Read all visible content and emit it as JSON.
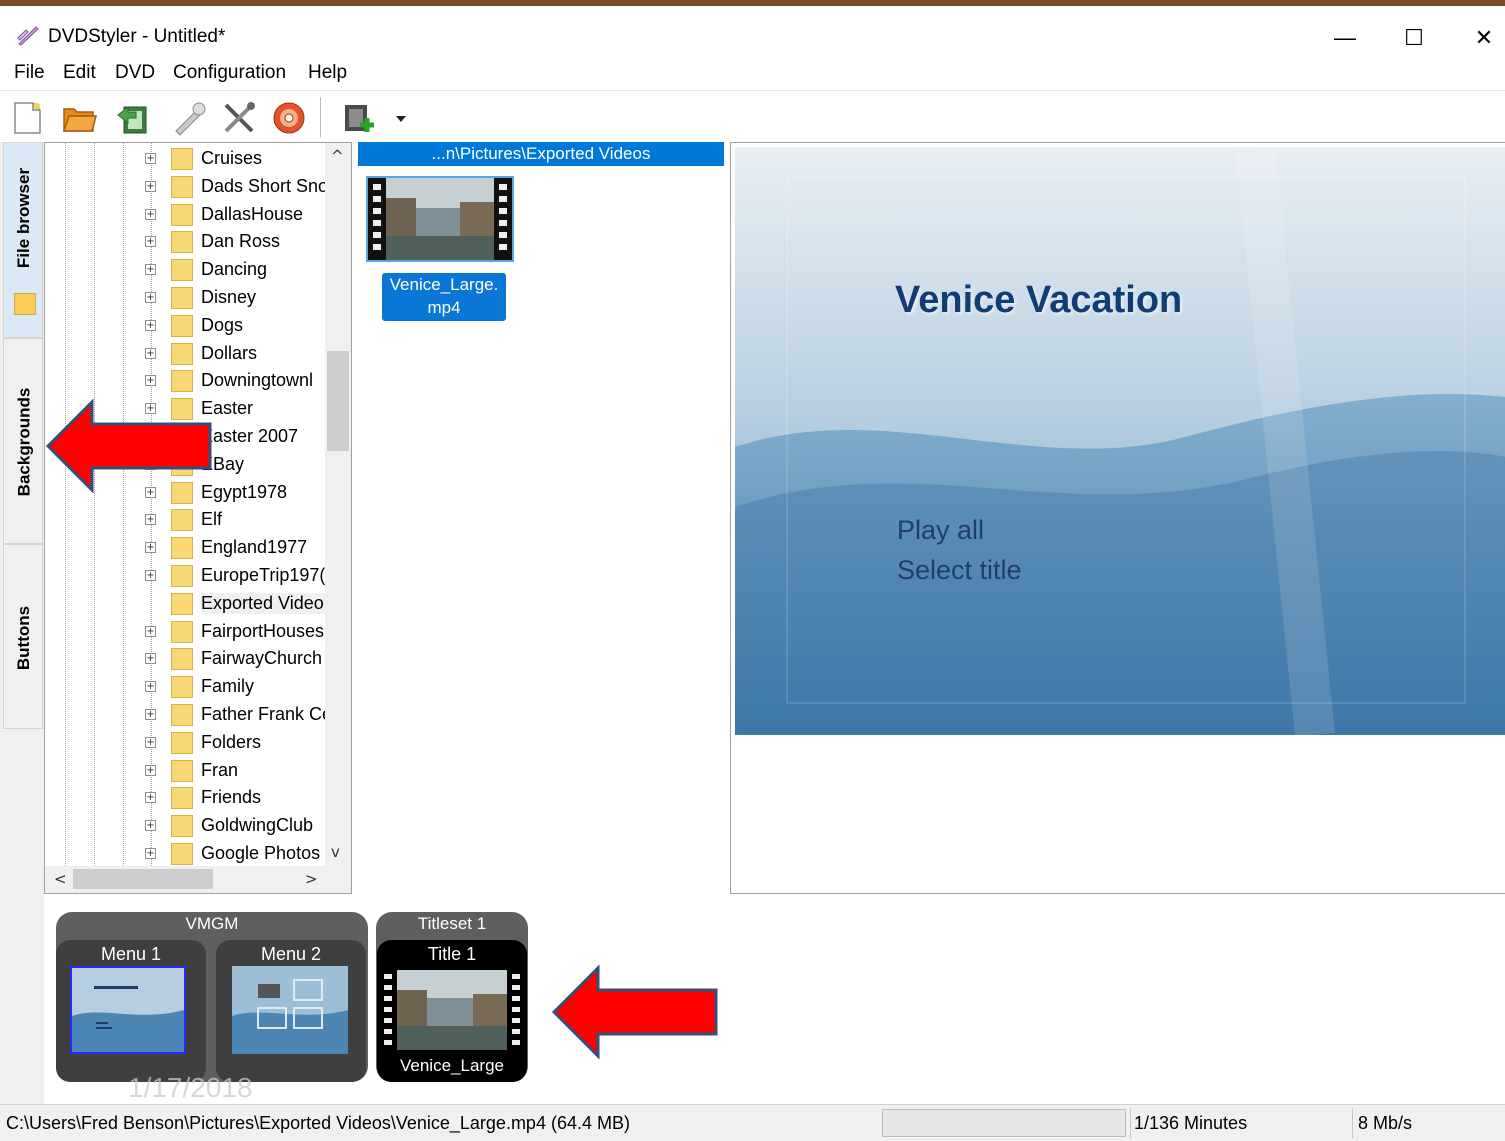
{
  "window": {
    "title": "DVDStyler - Untitled*",
    "minimize_glyph": "—",
    "maximize_glyph": "☐",
    "close_glyph": "✕"
  },
  "menubar": [
    "File",
    "Edit",
    "DVD",
    "Configuration",
    "Help"
  ],
  "toolbar": {
    "items": [
      "new-project-icon",
      "open-project-icon",
      "save-project-icon",
      "settings-icon",
      "tools-icon",
      "burn-dvd-icon",
      "add-video-icon",
      "dropdown-arrow-icon"
    ]
  },
  "side_tabs": [
    "File browser",
    "Backgrounds",
    "Buttons"
  ],
  "folder_tree": {
    "items": [
      "Cruises",
      "Dads Short Sno",
      "DallasHouse",
      "Dan Ross",
      "Dancing",
      "Disney",
      "Dogs",
      "Dollars",
      "Downingtownl",
      "Easter",
      "Easter 2007",
      "EBay",
      "Egypt1978",
      "Elf",
      "England1977",
      "EuropeTrip197(",
      "Exported Video",
      "FairportHouses",
      "FairwayChurch",
      "Family",
      "Father Frank Ce",
      "Folders",
      "Fran",
      "Friends",
      "GoldwingClub",
      "Google Photos"
    ],
    "selected": "Exported Video",
    "scroll_up": "^",
    "scroll_down": "v",
    "scroll_left": "<",
    "scroll_right": ">"
  },
  "file_panel": {
    "path": "...n\\Pictures\\Exported Videos",
    "file_label": "Venice_Large.\nmp4"
  },
  "menu_preview": {
    "title": "Venice Vacation",
    "items": [
      "Play all",
      "Select title"
    ]
  },
  "titleset_panel": {
    "vmgm_label": "VMGM",
    "menu1": "Menu 1",
    "menu2": "Menu 2",
    "titleset_label": "Titleset 1",
    "title1": "Title 1",
    "title1_caption": "Venice_Large",
    "watermark_date": "1/17/2018"
  },
  "statusbar": {
    "path": "C:\\Users\\Fred Benson\\Pictures\\Exported Videos\\Venice_Large.mp4 (64.4 MB)",
    "minutes": "1/136 Minutes",
    "bitrate": "8 Mb/s"
  },
  "colors": {
    "selection_blue": "#0078d7",
    "menu_title": "#123d73",
    "arrow_red": "#ff0000"
  }
}
